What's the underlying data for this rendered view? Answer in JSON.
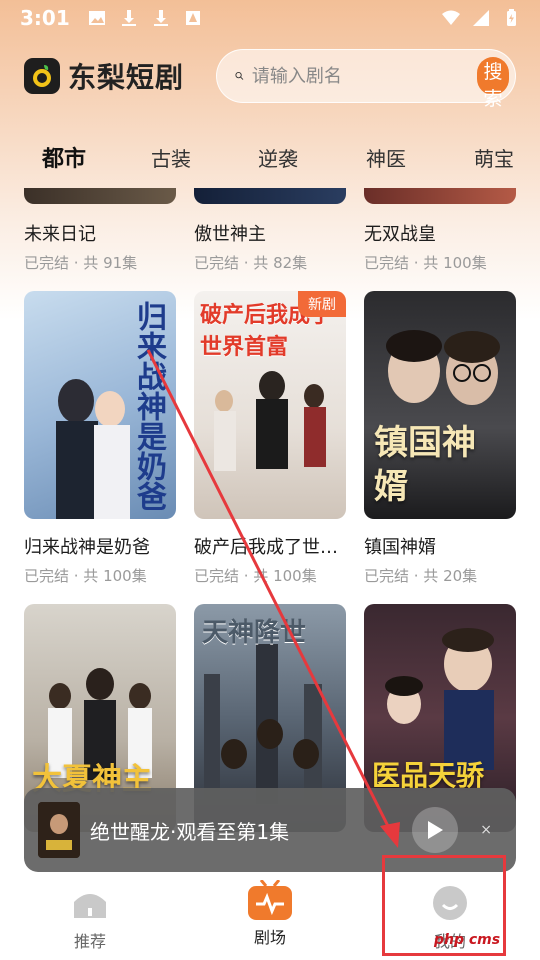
{
  "status": {
    "time": "3:01"
  },
  "header": {
    "app_name": "东梨短剧",
    "search_placeholder": "请输入剧名",
    "search_button": "搜索"
  },
  "tabs": [
    "都市",
    "古装",
    "逆袭",
    "神医",
    "萌宝"
  ],
  "rows": [
    [
      {
        "title": "未来日记",
        "sub": "已完结 · 共 91集"
      },
      {
        "title": "傲世神主",
        "sub": "已完结 · 共 82集"
      },
      {
        "title": "无双战皇",
        "sub": "已完结 · 共 100集"
      }
    ],
    [
      {
        "title": "归来战神是奶爸",
        "sub": "已完结 · 共 100集",
        "art": "归来战神是奶爸"
      },
      {
        "title": "破产后我成了世…",
        "sub": "已完结 · 共 100集",
        "art": "破产后我成了世界首富",
        "badge": "新剧"
      },
      {
        "title": "镇国神婿",
        "sub": "已完结 · 共 20集",
        "art": "镇国神婿"
      }
    ],
    [
      {
        "title": "",
        "sub": "",
        "art": "大夏神主"
      },
      {
        "title": "",
        "sub": "",
        "art": "天神降世"
      },
      {
        "title": "",
        "sub": "",
        "art": "医品天骄"
      }
    ]
  ],
  "mini_player": {
    "text": "绝世醒龙·观看至第1集",
    "close": "×"
  },
  "nav": [
    {
      "label": "推荐"
    },
    {
      "label": "剧场"
    },
    {
      "label": "我的"
    }
  ],
  "watermark": "php cms",
  "colors": {
    "accent": "#f07a2c",
    "annotation": "#e6393d"
  }
}
